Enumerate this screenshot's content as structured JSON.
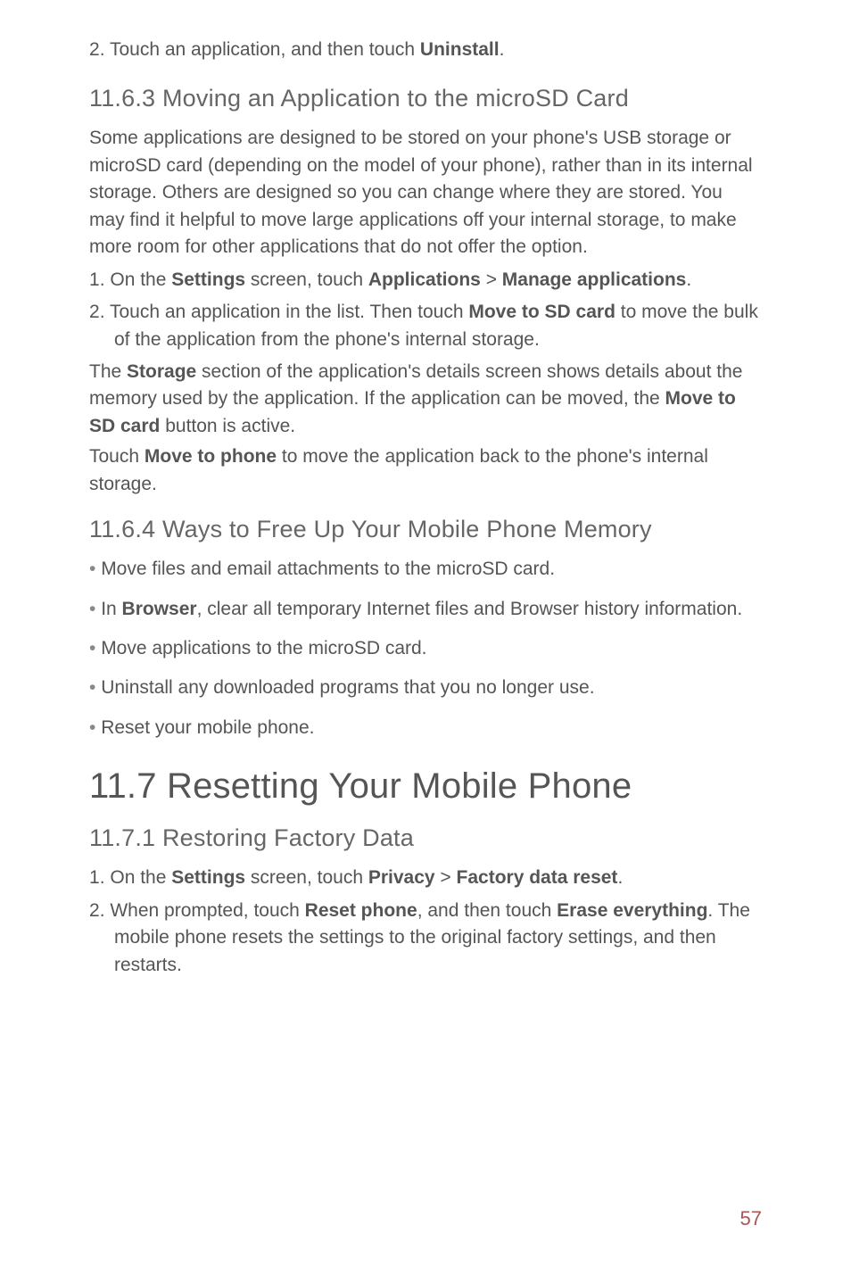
{
  "ol_top": {
    "item1": {
      "pre": "Touch an application, and then touch ",
      "b1": "Uninstall",
      "post": "."
    }
  },
  "h2_1163": "11.6.3  Moving an Application to the microSD Card",
  "p_1163": "Some applications are designed to be stored on your phone's USB storage or microSD card (depending on the model of your phone), rather than in its internal storage. Others are designed so you can change where they are stored. You may find it helpful to move large applications off your internal storage, to make more room for other applications that  do not offer the option.",
  "ol_1163": {
    "item1": {
      "pre": "On the ",
      "b1": "Settings",
      "mid1": " screen, touch ",
      "b2": "Applications",
      "gt": " > ",
      "b3": "Manage applications",
      "post": "."
    },
    "item2": {
      "pre": "Touch an application in the list. Then touch ",
      "b1": "Move to SD card",
      "post": "  to move the bulk of the application from the phone's internal storage."
    }
  },
  "p_storage": {
    "pre": "The ",
    "b1": "Storage",
    "mid1": " section of the application's details screen shows details about the memory used by the application. If the application can be moved, the ",
    "b2": "Move to SD card",
    "post": " button is active."
  },
  "p_move_phone": {
    "pre": "Touch ",
    "b1": "Move to phone",
    "post": " to move the application back to the phone's internal storage."
  },
  "h2_1164": "11.6.4  Ways to Free Up Your Mobile Phone Memory",
  "ul_1164": {
    "item1": "Move files and email attachments to the microSD card.",
    "item2": {
      "pre": "In ",
      "b1": "Browser",
      "post": ", clear all temporary Internet files and Browser history information."
    },
    "item3": "Move applications to the microSD card.",
    "item4": "Uninstall any downloaded programs that you no longer use.",
    "item5": "Reset your mobile phone."
  },
  "h1_117": "11.7  Resetting Your Mobile Phone",
  "h2_1171": "11.7.1  Restoring Factory Data",
  "ol_1171": {
    "item1": {
      "pre": "On the ",
      "b1": "Settings",
      "mid1": " screen, touch ",
      "b2": "Privacy",
      "gt": " > ",
      "b3": "Factory data reset",
      "post": "."
    },
    "item2": {
      "pre": "When prompted, touch ",
      "b1": "Reset phone",
      "mid1": ", and then touch ",
      "b2": "Erase everything",
      "post": ". The mobile phone resets the settings to the original factory settings, and then restarts."
    }
  },
  "page_number": "57"
}
